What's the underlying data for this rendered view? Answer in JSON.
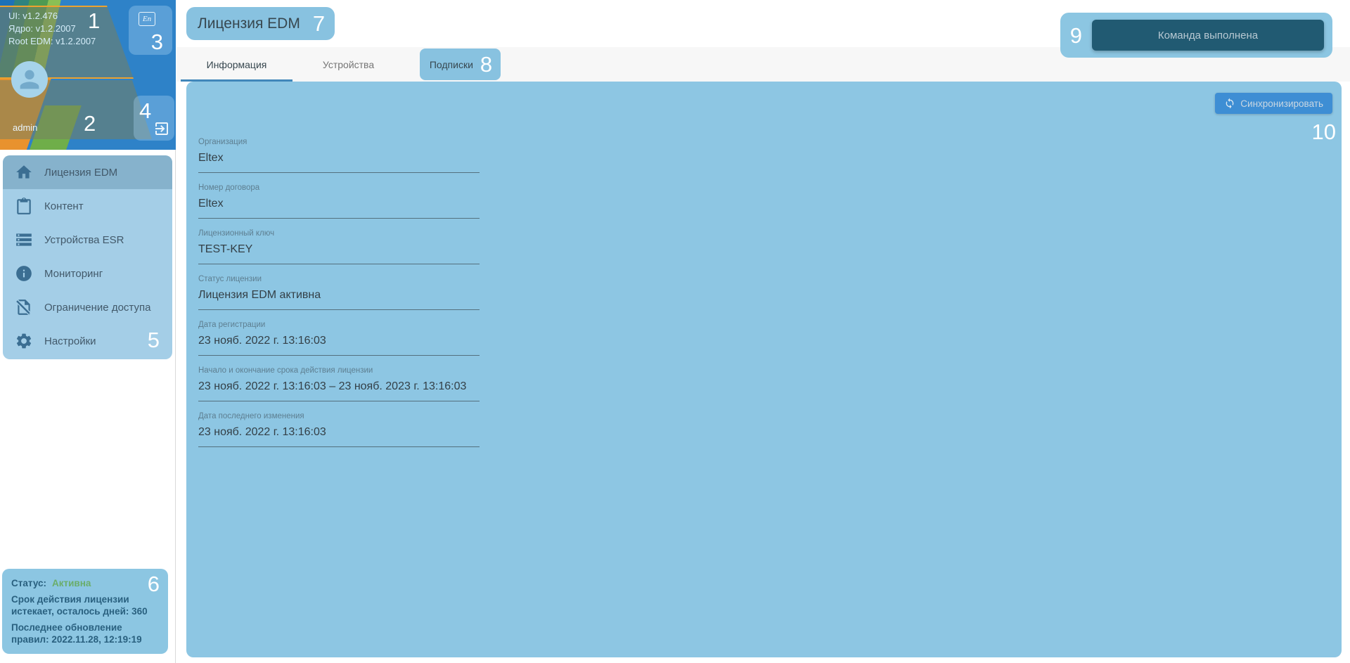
{
  "callouts": [
    "1",
    "2",
    "3",
    "4",
    "5",
    "6",
    "7",
    "8",
    "9",
    "10"
  ],
  "sidebar": {
    "versions": {
      "ui": "UI: v1.2.476",
      "core": "Ядро: v1.2.2007",
      "root": "Root EDM: v1.2.2007"
    },
    "user": "admin",
    "language_badge": "En",
    "menu": [
      {
        "label": "Лицензия EDM",
        "icon": "home",
        "active": true
      },
      {
        "label": "Контент",
        "icon": "clipboard",
        "active": false
      },
      {
        "label": "Устройства ESR",
        "icon": "server-rack",
        "active": false
      },
      {
        "label": "Мониторинг",
        "icon": "info-circle",
        "active": false
      },
      {
        "label": "Ограничение доступа",
        "icon": "document-slash",
        "active": false
      },
      {
        "label": "Настройки",
        "icon": "gear",
        "active": false
      }
    ],
    "status": {
      "label": "Статус:",
      "value": "Активна",
      "expiry": "Срок действия лицензии истекает, осталось дней: 360",
      "updated": "Последнее обновление правил: 2022.11.28, 12:19:19"
    }
  },
  "main": {
    "title": "Лицензия EDM",
    "tabs": [
      {
        "label": "Информация",
        "active": true
      },
      {
        "label": "Устройства",
        "active": false
      },
      {
        "label": "Подписки",
        "active": false
      }
    ],
    "toast": "Команда выполнена",
    "sync_button": "Синхронизировать",
    "fields": [
      {
        "label": "Организация",
        "value": "Eltex"
      },
      {
        "label": "Номер договора",
        "value": "Eltex"
      },
      {
        "label": "Лицензионный ключ",
        "value": "TEST-KEY"
      },
      {
        "label": "Статус лицензии",
        "value": "Лицензия EDM активна"
      },
      {
        "label": "Дата регистрации",
        "value": "23 нояб. 2022 г. 13:16:03"
      },
      {
        "label": "Начало и окончание срока действия лицензии",
        "value": "23 нояб. 2022 г. 13:16:03 – 23 нояб. 2023 г. 13:16:03"
      },
      {
        "label": "Дата последнего изменения",
        "value": "23 нояб. 2022 г. 13:16:03"
      }
    ]
  },
  "icons": {
    "language": "En-box",
    "logout": "exit-arrow",
    "sync": "circular-arrows",
    "avatar": "person-silhouette",
    "menu": [
      "house",
      "clipboard",
      "server-rack",
      "info-circle",
      "document-slash",
      "gear"
    ]
  },
  "colors": {
    "accent_blue": "#3e8ed4",
    "content_panel": "#8dc6e3",
    "menu_panel": "#a4cee7",
    "selected_item": "#86b2cc",
    "highlight_pill": "#88c2e0",
    "toast_teal": "#215a72",
    "status_green": "#6aad6a",
    "tab_underline": "#4187ba",
    "brand_orange": "#e8922e",
    "brand_green": "#4f9a52",
    "brand_blue": "#2e82c8"
  }
}
